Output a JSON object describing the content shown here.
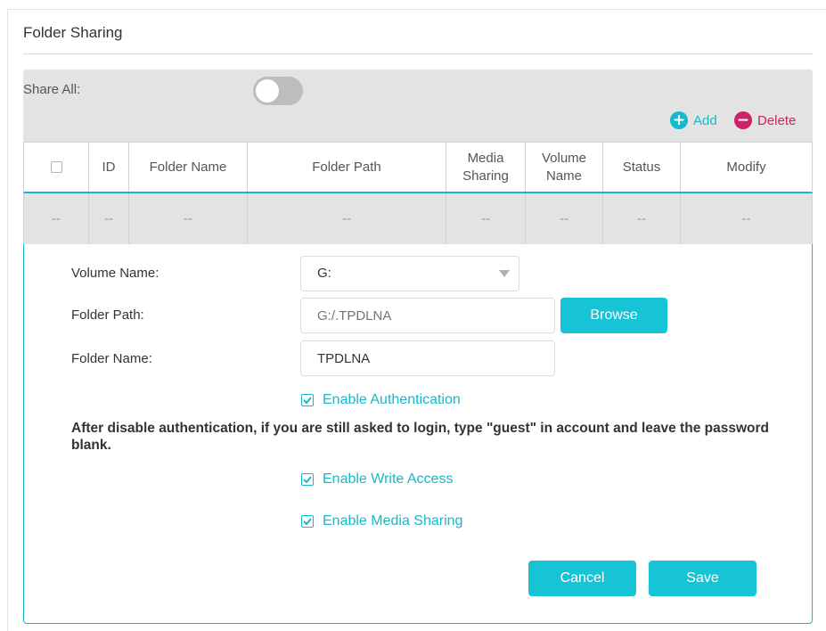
{
  "section": {
    "title": "Folder Sharing"
  },
  "share_all": {
    "label": "Share All:",
    "enabled": false
  },
  "actions": {
    "add_label": "Add",
    "delete_label": "Delete",
    "add_icon": "plus-circle-icon",
    "delete_icon": "minus-circle-icon"
  },
  "table": {
    "headers": [
      "ID",
      "Folder Name",
      "Folder Path",
      "Media Sharing",
      "Volume Name",
      "Status",
      "Modify"
    ],
    "rows": [
      [
        "--",
        "--",
        "--",
        "--",
        "--",
        "--",
        "--",
        "--"
      ]
    ]
  },
  "form": {
    "volume_label": "Volume Name:",
    "volume_value": "G:",
    "path_label": "Folder Path:",
    "path_placeholder": "G:/.TPDLNA",
    "browse_label": "Browse",
    "name_label": "Folder Name:",
    "name_value": "TPDLNA",
    "enable_auth_label": "Enable Authentication",
    "enable_auth_checked": true,
    "notice": "After disable authentication, if you are still asked to login, type \"guest\" in account and leave the password blank.",
    "write_access_label": "Enable Write Access",
    "write_access_checked": true,
    "media_sharing_label": "Enable Media Sharing",
    "media_sharing_checked": true,
    "cancel_label": "Cancel",
    "save_label": "Save"
  },
  "colors": {
    "accent": "#17b8c8",
    "button": "#17c4d6",
    "danger": "#cc2266",
    "panel_gray": "#e3e3e3"
  }
}
